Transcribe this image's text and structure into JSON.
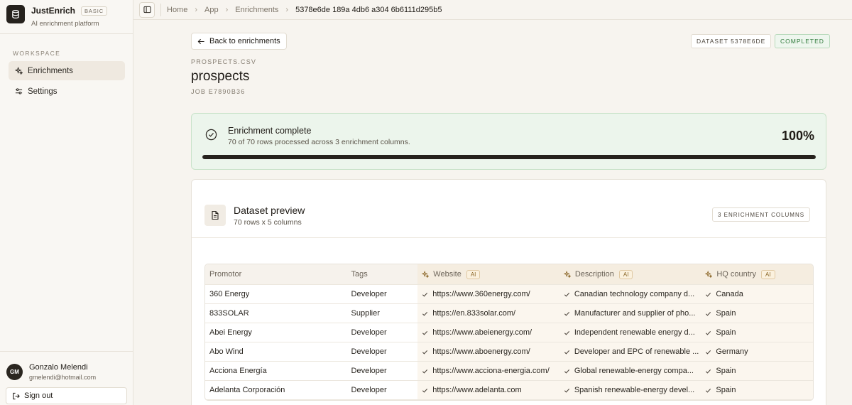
{
  "brand": {
    "name": "JustEnrich",
    "plan": "BASIC",
    "subtitle": "AI enrichment platform"
  },
  "sidebar": {
    "section_label": "WORKSPACE",
    "items": [
      {
        "label": "Enrichments",
        "icon": "sparkles-icon",
        "active": true
      },
      {
        "label": "Settings",
        "icon": "sliders-icon",
        "active": false
      }
    ]
  },
  "user": {
    "initials": "GM",
    "name": "Gonzalo Melendi",
    "email": "gmelendi@hotmail.com"
  },
  "signout_label": "Sign out",
  "breadcrumb": [
    "Home",
    "App",
    "Enrichments",
    "5378e6de 189a 4db6 a304 6b6111d295b5"
  ],
  "back_label": "Back to enrichments",
  "dataset_badge": "DATASET 5378E6DE",
  "status_badge": "COMPLETED",
  "file_label": "PROSPECTS.CSV",
  "title": "prospects",
  "job_label": "JOB E7890B36",
  "progress": {
    "title": "Enrichment complete",
    "subtitle": "70 of 70 rows processed across 3 enrichment columns.",
    "percent_label": "100%",
    "fraction": 1.0
  },
  "preview": {
    "title": "Dataset preview",
    "subtitle": "70 rows x 5 columns",
    "badge": "3 ENRICHMENT COLUMNS"
  },
  "table": {
    "columns": [
      {
        "label": "Promotor",
        "ai": false
      },
      {
        "label": "Tags",
        "ai": false
      },
      {
        "label": "Website",
        "ai": true
      },
      {
        "label": "Description",
        "ai": true
      },
      {
        "label": "HQ country",
        "ai": true
      }
    ],
    "ai_tag": "AI",
    "rows": [
      [
        "360 Energy",
        "Developer",
        "https://www.360energy.com/",
        "Canadian technology company d...",
        "Canada"
      ],
      [
        "833SOLAR",
        "Supplier",
        "https://en.833solar.com/",
        "Manufacturer and supplier of pho...",
        "Spain"
      ],
      [
        "Abei Energy",
        "Developer",
        "https://www.abeienergy.com/",
        "Independent renewable energy d...",
        "Spain"
      ],
      [
        "Abo Wind",
        "Developer",
        "https://www.aboenergy.com/",
        "Developer and EPC of renewable ...",
        "Germany"
      ],
      [
        "Acciona Energía",
        "Developer",
        "https://www.acciona-energia.com/",
        "Global renewable-energy compa...",
        "Spain"
      ],
      [
        "Adelanta Corporación",
        "Developer",
        "https://www.adelanta.com",
        "Spanish renewable-energy devel...",
        "Spain"
      ]
    ]
  }
}
